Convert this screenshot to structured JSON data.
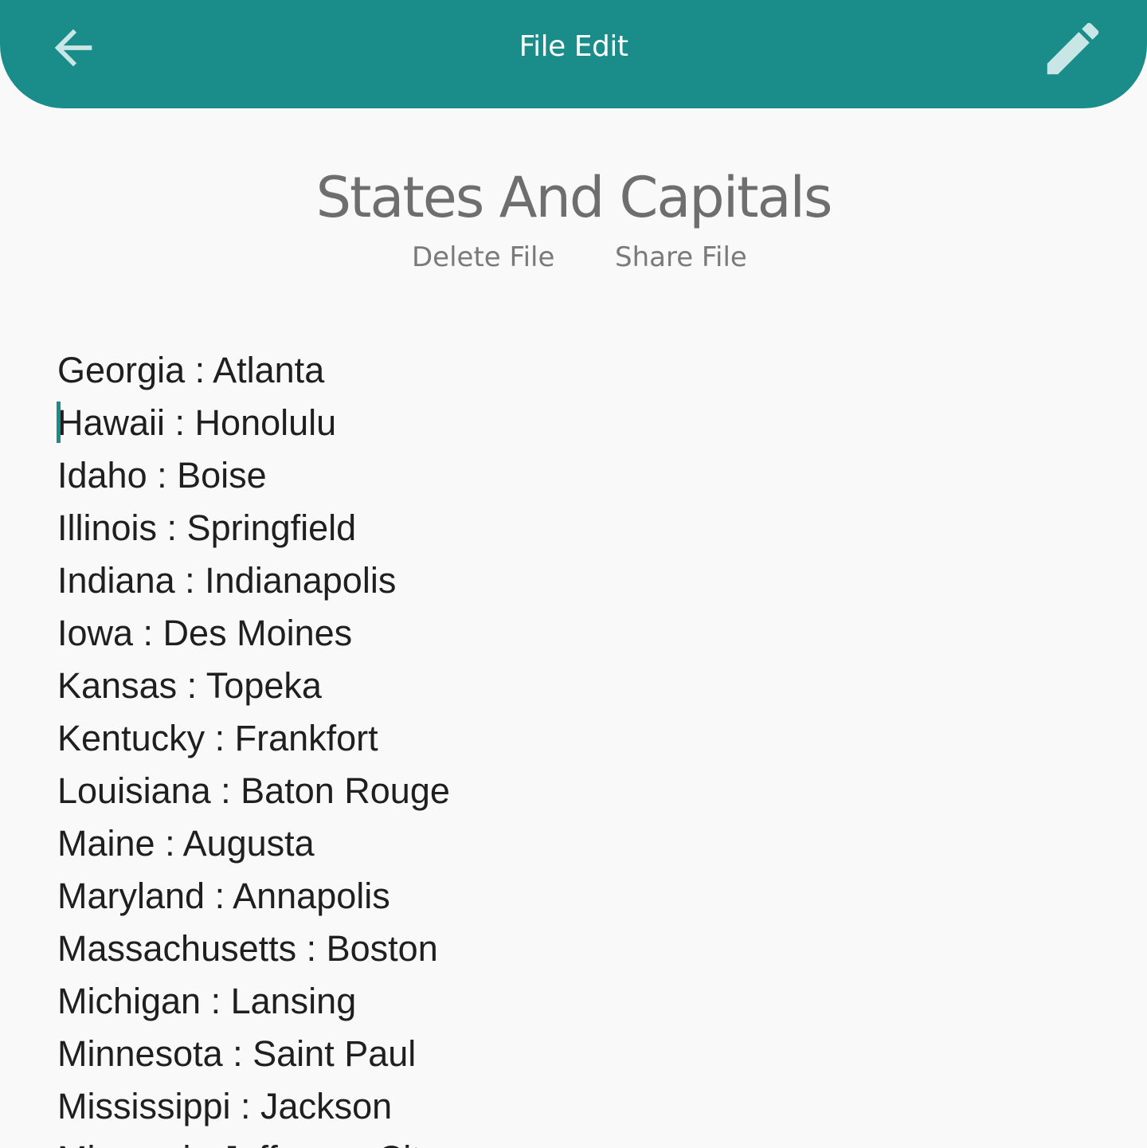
{
  "app_bar": {
    "title": "File Edit",
    "back_icon": "arrow-left-icon",
    "edit_icon": "pencil-icon",
    "color": "#1a8c8a"
  },
  "file": {
    "title": "States And Capitals",
    "actions": {
      "delete_label": "Delete File",
      "share_label": "Share File"
    }
  },
  "editor": {
    "lines": [
      "Georgia : Atlanta",
      "Hawaii : Honolulu",
      "Idaho : Boise",
      "Illinois : Springfield",
      "Indiana : Indianapolis",
      "Iowa : Des Moines",
      "Kansas : Topeka",
      "Kentucky : Frankfort",
      "Louisiana : Baton Rouge",
      "Maine : Augusta",
      "Maryland : Annapolis",
      "Massachusetts : Boston",
      "Michigan : Lansing",
      "Minnesota : Saint Paul",
      "Mississippi : Jackson",
      "Missouri : Jefferson City"
    ]
  }
}
